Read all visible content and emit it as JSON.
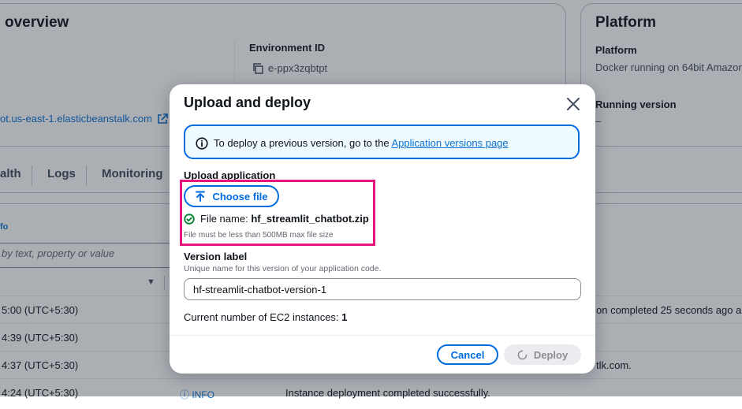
{
  "background": {
    "overview": {
      "title": "overview",
      "environment_id_label": "Environment ID",
      "environment_id_value": "e-ppx3zqbtpt",
      "domain": "ot.us-east-1.elasticbeanstalk.com"
    },
    "platform": {
      "title": "Platform",
      "platform_label": "Platform",
      "platform_value": "Docker running on 64bit Amazon",
      "running_version_label": "Running version",
      "running_version_value": "–"
    },
    "tabs": [
      "alth",
      "Logs",
      "Monitoring"
    ],
    "events": {
      "info_label": "fo",
      "filter_placeholder": "by text, property or value",
      "rows": [
        {
          "time": "5:00 (UTC+5:30)",
          "message": "on completed 25 seconds ago and"
        },
        {
          "time": "4:39 (UTC+5:30)",
          "message": ""
        },
        {
          "time": "4:37 (UTC+5:30)",
          "message": "tlk.com."
        },
        {
          "time": "4:24 (UTC+5:30)",
          "message": "Instance deployment completed successfully."
        }
      ],
      "last_row_info": "INFO"
    }
  },
  "modal": {
    "title": "Upload and deploy",
    "alert": {
      "text": "To deploy a previous version, go to the ",
      "link": "Application versions page"
    },
    "upload": {
      "label": "Upload application",
      "button_label": "Choose file",
      "file_name_prefix": "File name: ",
      "file_name": "hf_streamlit_chatbot.zip",
      "hint": "File must be less than 500MB max file size"
    },
    "version": {
      "label": "Version label",
      "description": "Unique name for this version of your application code.",
      "value": "hf-streamlit-chatbot-version-1"
    },
    "ec2": {
      "label": "Current number of EC2 instances: ",
      "count": "1"
    },
    "footer": {
      "cancel_label": "Cancel",
      "deploy_label": "Deploy"
    }
  },
  "colors": {
    "accent": "#006ce0",
    "link": "#0972d3",
    "highlight": "#e5157a",
    "success": "#00802f",
    "overlay": "#232b37"
  },
  "icons": [
    "copy-icon",
    "external-link-icon",
    "info-icon",
    "close-icon",
    "upload-icon",
    "success-check-icon",
    "spinner-icon",
    "caret-down-icon"
  ]
}
